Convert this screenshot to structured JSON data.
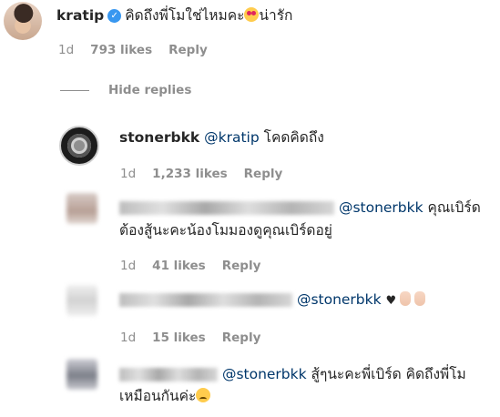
{
  "comment_main": {
    "username": "kratip",
    "text": "คิดถึงพี่โมใช่ไหมคะ",
    "text_after": "น่ารัก",
    "time": "1d",
    "likes": "793 likes",
    "reply": "Reply"
  },
  "hide_replies": "Hide replies",
  "replies": [
    {
      "username": "stonerbkk",
      "mention": "@kratip",
      "text": "โคดคิดถึง",
      "time": "1d",
      "likes": "1,233 likes",
      "reply": "Reply"
    },
    {
      "mention": "@stonerbkk",
      "text_line1": "คุณเบิร์ด",
      "text_line2": "ต้องสู้นะคะน้องโมมองดูคุณเบิร์ดอยู่",
      "time": "1d",
      "likes": "41 likes",
      "reply": "Reply"
    },
    {
      "mention": "@stonerbkk",
      "time": "1d",
      "likes": "15 likes",
      "reply": "Reply"
    },
    {
      "mention": "@stonerbkk",
      "text_line1": "สู้ๆนะคะพี่เบิร์ด คิดถึงพี่โม",
      "text_line2": "เหมือนกันค่ะ"
    }
  ],
  "colors": {
    "mention": "#00376b",
    "meta": "#8e8e8e",
    "verified": "#3897f0"
  },
  "icons": [
    "verified-badge-icon",
    "heart-eyes-emoji-icon",
    "black-heart-icon",
    "peace-hand-icon",
    "sad-face-emoji-icon"
  ]
}
